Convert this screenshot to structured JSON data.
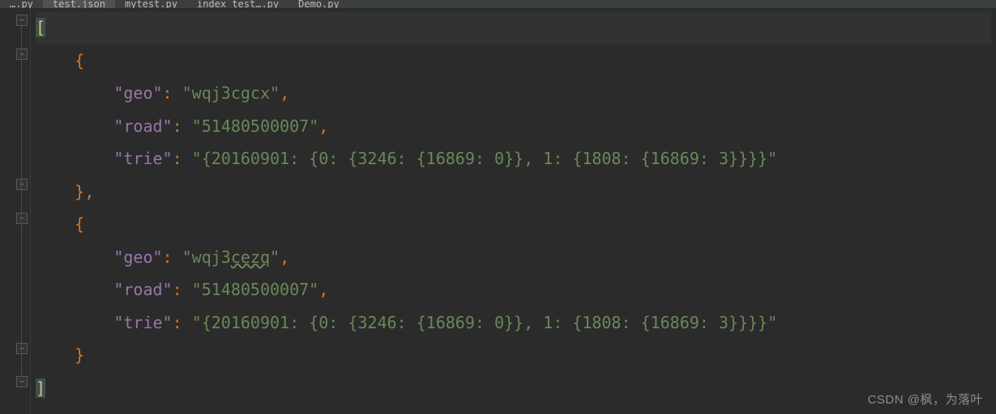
{
  "tabs": {
    "t1": "….py",
    "t2": "test.json",
    "t3": "mytest.py",
    "t4": "index_test….py",
    "t5": "Demo.py"
  },
  "code": {
    "open_bracket": "[",
    "close_bracket": "]",
    "brace_open": "{",
    "brace_close": "}",
    "brace_close_comma": "},",
    "obj1": {
      "k1": "\"geo\"",
      "v1": "\"wqj3cgcx\"",
      "k2": "\"road\"",
      "v2": "\"51480500007\"",
      "k3": "\"trie\"",
      "v3": "\"{20160901: {0: {3246: {16869: 0}}, 1: {1808: {16869: 3}}}}\""
    },
    "obj2": {
      "k1": "\"geo\"",
      "v1_a": "\"wqj3",
      "v1_b": "cezq",
      "v1_c": "\"",
      "k2": "\"road\"",
      "v2": "\"51480500007\"",
      "k3": "\"trie\"",
      "v3": "\"{20160901: {0: {3246: {16869: 0}}, 1: {1808: {16869: 3}}}}\""
    },
    "colon": ": ",
    "comma": ","
  },
  "watermark": "CSDN @枫，为落叶"
}
